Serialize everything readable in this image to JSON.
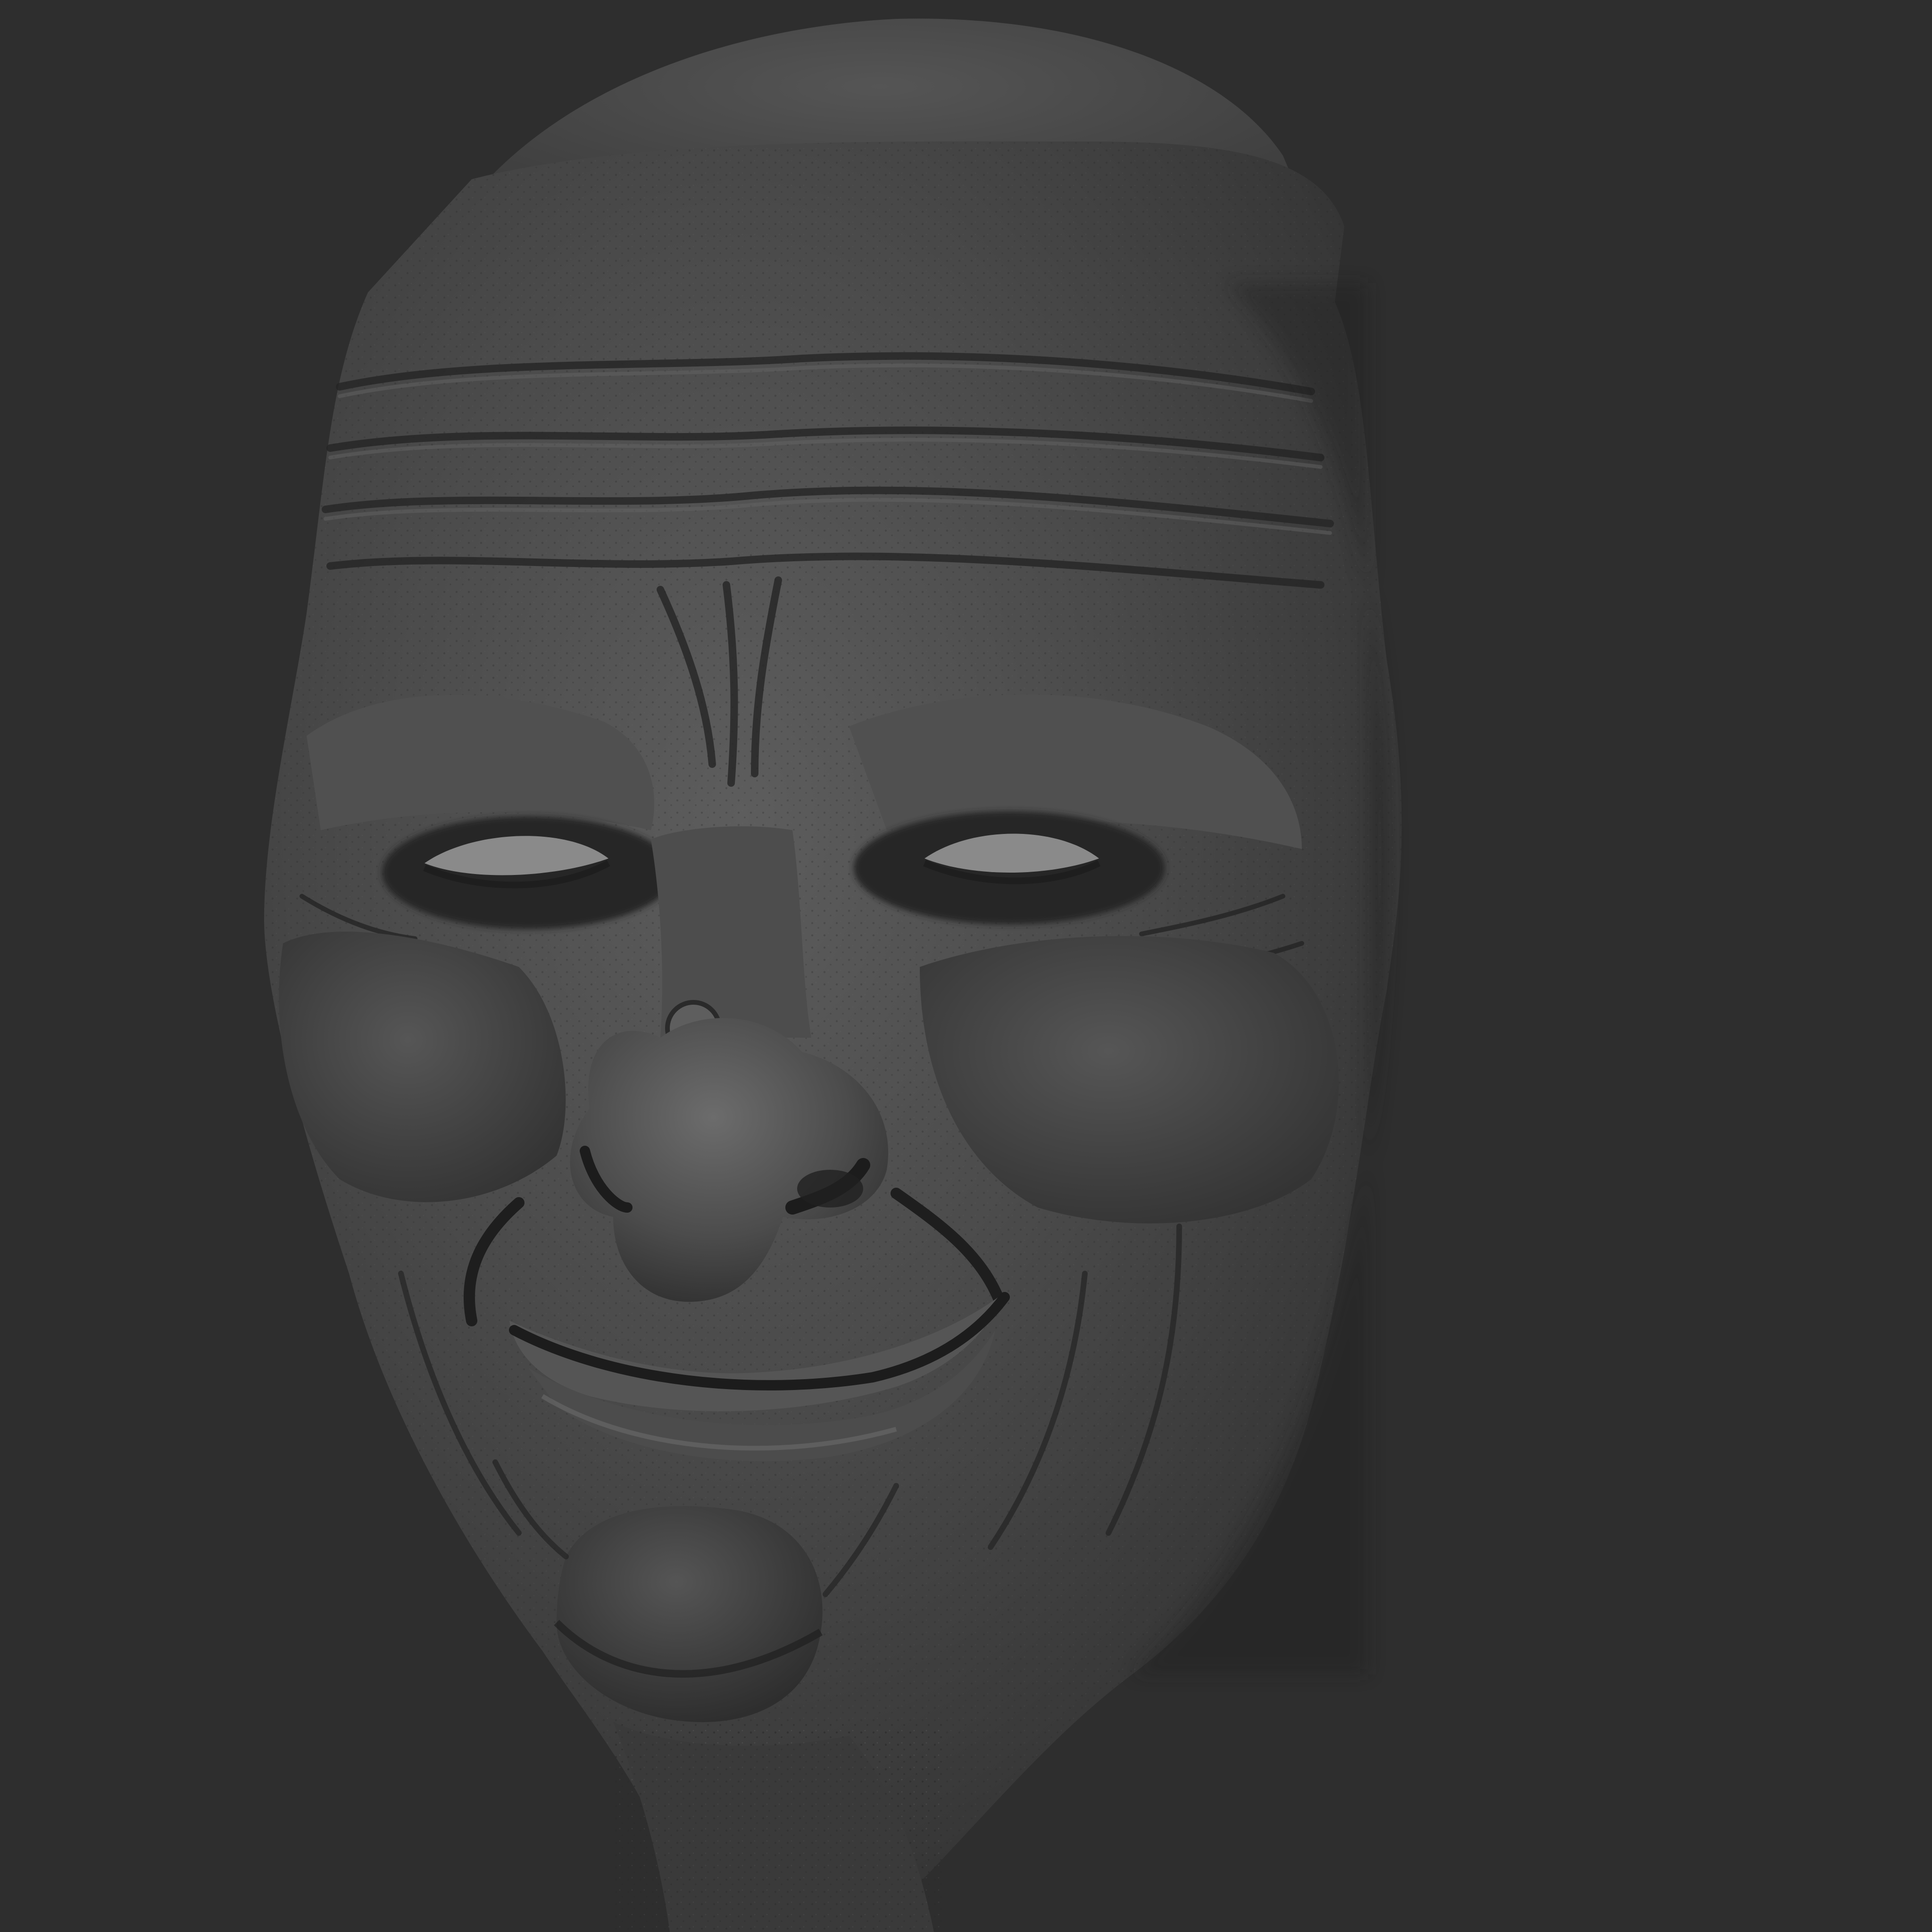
{
  "viewport": {
    "background_color": "#2e2e2e",
    "subject": "sculpted-head-render"
  },
  "colors": {
    "skin_light": "#6c6c6c",
    "skin_mid": "#4a4a4a",
    "skin_dark": "#2f2f2f",
    "shadow": "#1e1e1e",
    "crease": "#232323",
    "highlight": "#9a9a9a"
  },
  "icons": {
    "render": "sculpt-head-icon"
  }
}
